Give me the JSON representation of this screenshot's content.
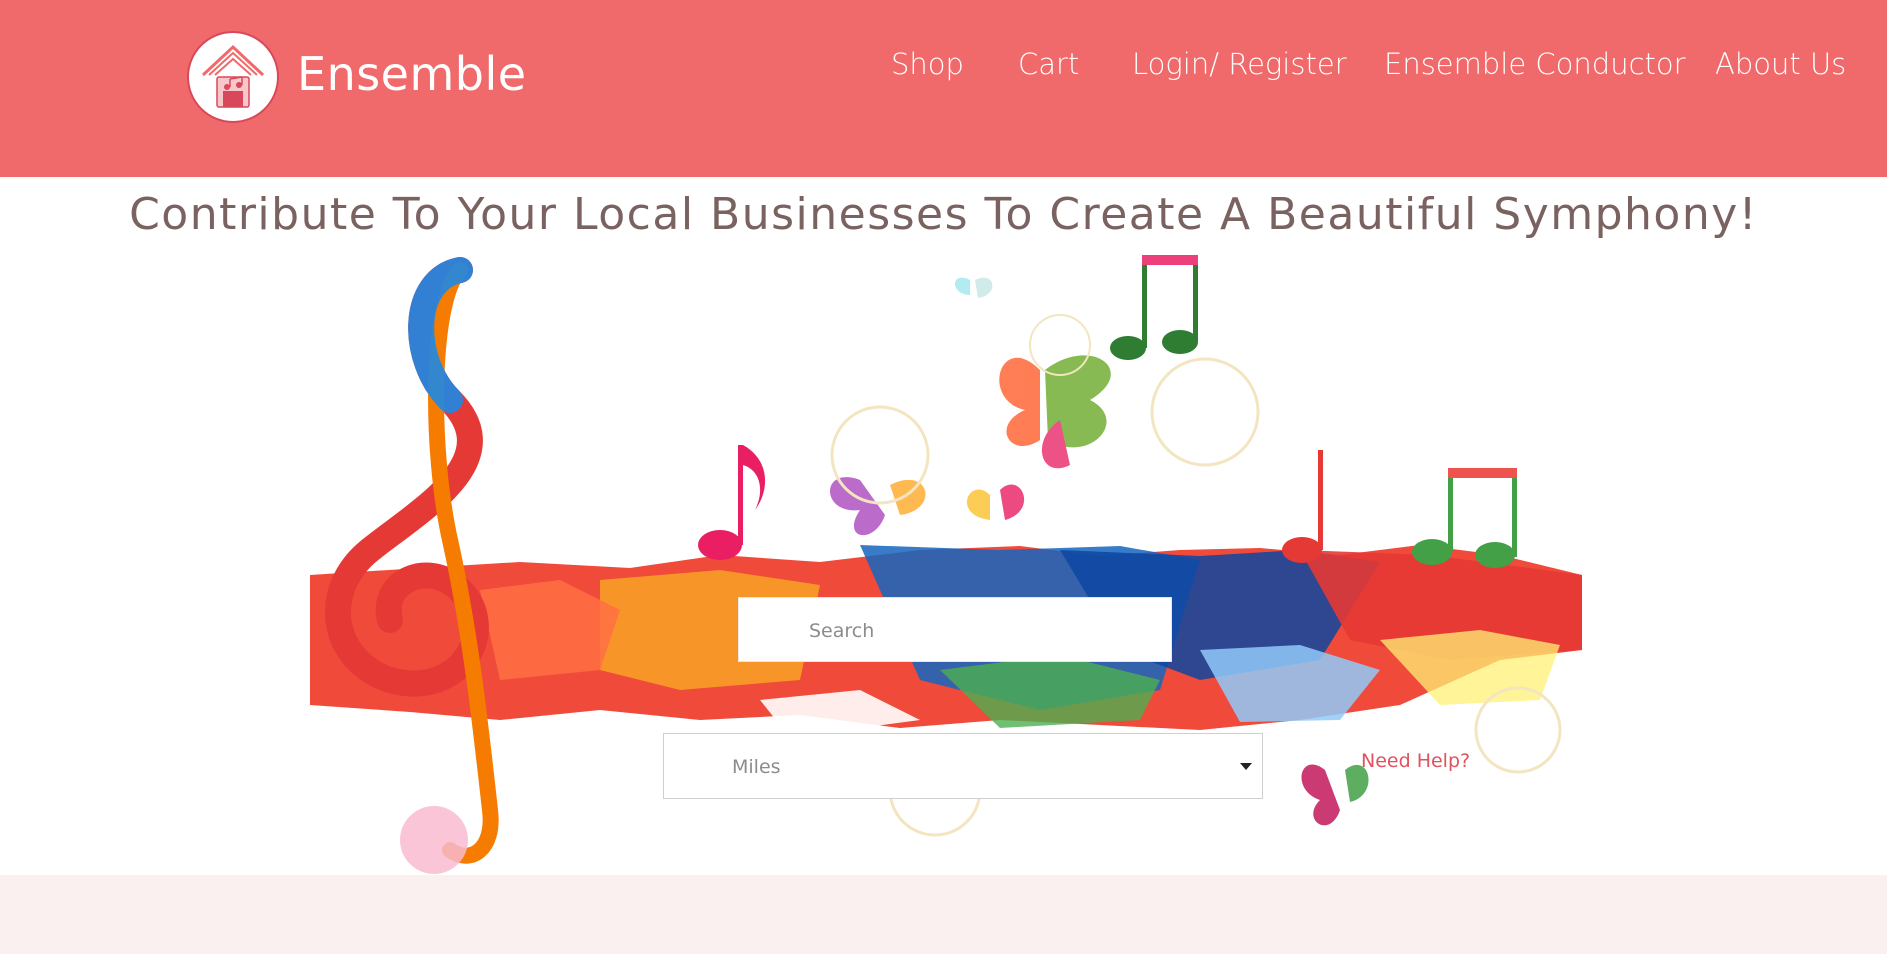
{
  "brand": {
    "name": "Ensemble",
    "logo_icon": "house-music-logo-icon"
  },
  "nav": {
    "items": [
      {
        "label": "Shop"
      },
      {
        "label": "Cart"
      },
      {
        "label": "Login/ Register"
      },
      {
        "label": "Ensemble Conductor"
      },
      {
        "label": "About Us"
      }
    ]
  },
  "hero": {
    "tagline": "Contribute To Your Local Businesses To Create A Beautiful Symphony!",
    "image": "colorful-music-notes-illustration"
  },
  "search": {
    "placeholder": "Search",
    "value": ""
  },
  "distance": {
    "selected": "Miles"
  },
  "help": {
    "label": "Need Help?"
  },
  "colors": {
    "header_bg": "#f0696b",
    "tagline": "#7a6260",
    "help_link": "#e0525f",
    "footer_bg": "#fbf0f0"
  }
}
